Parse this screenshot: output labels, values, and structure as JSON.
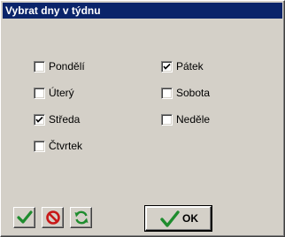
{
  "window": {
    "title": "Vybrat dny v týdnu"
  },
  "days": [
    {
      "label": "Pondělí",
      "checked": false
    },
    {
      "label": "Úterý",
      "checked": false
    },
    {
      "label": "Středa",
      "checked": true
    },
    {
      "label": "Čtvrtek",
      "checked": false
    },
    {
      "label": "Pátek",
      "checked": true
    },
    {
      "label": "Sobota",
      "checked": false
    },
    {
      "label": "Neděle",
      "checked": false
    }
  ],
  "buttons": {
    "ok_label": "OK",
    "select_all_icon": "green-check-icon",
    "clear_icon": "red-no-icon",
    "refresh_icon": "green-refresh-icon"
  },
  "colors": {
    "title_bar": "#0a246a",
    "face": "#d4d0c8",
    "check_green": "#1e8c2e",
    "no_red": "#c81818"
  }
}
